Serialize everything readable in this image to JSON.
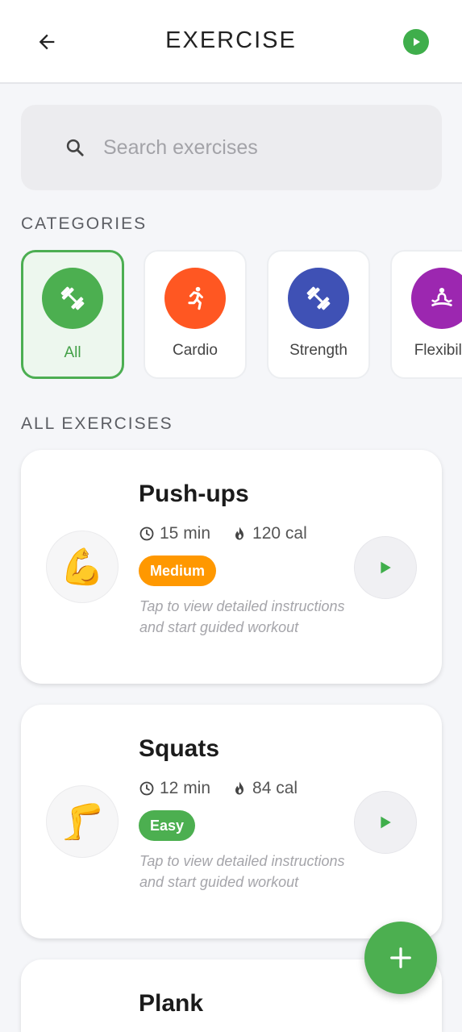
{
  "header": {
    "title": "EXERCISE",
    "back_icon": "arrow-left-icon",
    "action_icon": "play-circle-icon"
  },
  "search": {
    "placeholder": "Search exercises",
    "value": ""
  },
  "categories": {
    "title": "CATEGORIES",
    "items": [
      {
        "label": "All",
        "icon": "dumbbell-icon",
        "color": "#4caf50",
        "selected": true
      },
      {
        "label": "Cardio",
        "icon": "running-icon",
        "color": "#ff5722",
        "selected": false
      },
      {
        "label": "Strength",
        "icon": "dumbbell-icon",
        "color": "#3f51b5",
        "selected": false
      },
      {
        "label": "Flexibilit",
        "icon": "meditation-icon",
        "color": "#9c27b0",
        "selected": false
      }
    ]
  },
  "exercises": {
    "title": "ALL EXERCISES",
    "items": [
      {
        "name": "Push-ups",
        "emoji": "💪",
        "duration": "15 min",
        "calories": "120 cal",
        "difficulty": "Medium",
        "difficulty_color": "#ff9800",
        "description": "Tap to view detailed instructions and start guided workout"
      },
      {
        "name": "Squats",
        "emoji": "🦵",
        "duration": "12 min",
        "calories": "84 cal",
        "difficulty": "Easy",
        "difficulty_color": "#4caf50",
        "description": "Tap to view detailed instructions and start guided workout"
      },
      {
        "name": "Plank"
      }
    ]
  },
  "fab": {
    "icon": "plus-icon"
  },
  "colors": {
    "accent": "#4caf50",
    "background": "#f5f6f9"
  }
}
